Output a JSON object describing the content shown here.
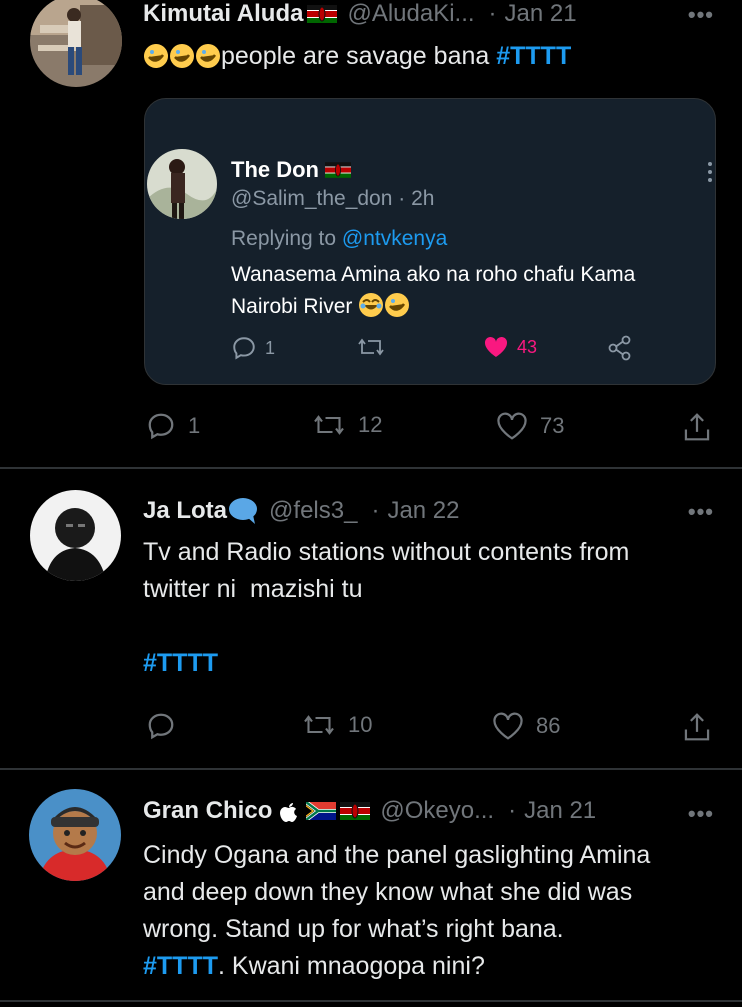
{
  "tweets": [
    {
      "name": "Kimutai Aluda",
      "handle": "@AludaKi...",
      "dot": "·",
      "time": "Jan 21",
      "text": "people are savage bana",
      "hashtag": "#TTTT",
      "counts": {
        "reply": "1",
        "retweet": "12",
        "like": "73"
      },
      "quote": {
        "name": "The Don",
        "handle": "@Salim_the_don · 2h",
        "replying_prefix": "Replying to",
        "replying_mention": "@ntvkenya",
        "text_line1": "Wanasema Amina ako na roho chafu Kama",
        "text_line2": "Nairobi River",
        "counts": {
          "reply": "1",
          "like": "43"
        }
      }
    },
    {
      "name": "Ja Lota",
      "handle": "@fels3_",
      "dot": "·",
      "time": "Jan 22",
      "text_line1": "Tv and Radio stations without contents from",
      "text_line2": "twitter ni  mazishi tu",
      "hashtag": "#TTTT",
      "counts": {
        "retweet": "10",
        "like": "86"
      }
    },
    {
      "name": "Gran Chico",
      "handle": "@Okeyo...",
      "dot": "·",
      "time": "Jan 21",
      "text_line1": "Cindy Ogana and the panel gaslighting Amina",
      "text_line2": "and deep down they know what she did was",
      "text_line3": "wrong. Stand up for what’s right bana.",
      "hashtag": "#TTTT",
      "text_tail": ". Kwani mnaogopa nini?"
    }
  ],
  "more_label": "•••",
  "colors": {
    "background": "#000000",
    "accent": "#1d9bf0",
    "like": "#f91880",
    "muted": "#71767b",
    "card": "#15202b"
  },
  "icons": [
    "reply-icon",
    "retweet-icon",
    "like-icon",
    "share-icon",
    "more-icon",
    "kenya-flag-icon",
    "south-africa-flag-icon",
    "apple-icon",
    "speech-bubble-icon",
    "rofl-emoji-icon",
    "joy-emoji-icon"
  ]
}
